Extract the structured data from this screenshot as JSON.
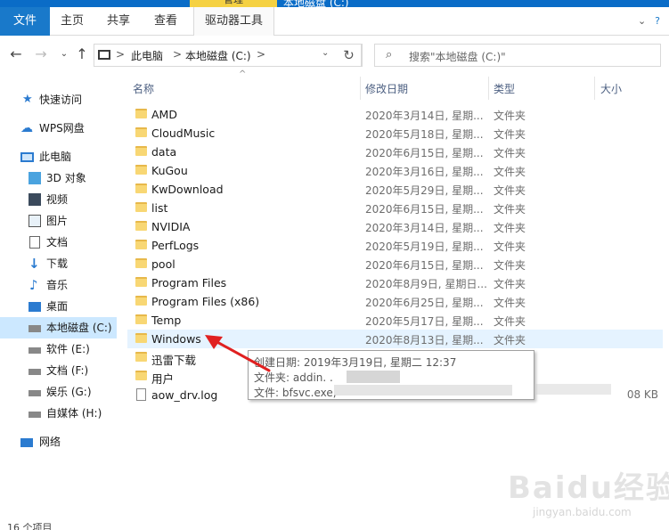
{
  "titlebar": {
    "manage_label": "管理",
    "title": "本地磁盘 (C:)"
  },
  "ribbon": {
    "tabs": {
      "file": "文件",
      "home": "主页",
      "share": "共享",
      "view": "查看",
      "drive_tools": "驱动器工具"
    }
  },
  "address": {
    "segments": [
      "此电脑",
      "本地磁盘 (C:)"
    ],
    "separator": ">",
    "search_placeholder": "搜索\"本地磁盘 (C:)\""
  },
  "nav": {
    "items": [
      {
        "label": "快速访问",
        "icon": "star-icon"
      },
      {
        "label": "WPS网盘",
        "icon": "cloud-icon"
      },
      {
        "label": "此电脑",
        "icon": "computer-icon"
      },
      {
        "label": "3D 对象",
        "icon": "cube-icon"
      },
      {
        "label": "视频",
        "icon": "video-icon"
      },
      {
        "label": "图片",
        "icon": "picture-icon"
      },
      {
        "label": "文档",
        "icon": "document-icon"
      },
      {
        "label": "下载",
        "icon": "download-icon"
      },
      {
        "label": "音乐",
        "icon": "music-icon"
      },
      {
        "label": "桌面",
        "icon": "desktop-icon"
      },
      {
        "label": "本地磁盘 (C:)",
        "icon": "drive-icon",
        "selected": true
      },
      {
        "label": "软件 (E:)",
        "icon": "drive-icon"
      },
      {
        "label": "文档 (F:)",
        "icon": "drive-icon"
      },
      {
        "label": "娱乐 (G:)",
        "icon": "drive-icon"
      },
      {
        "label": "自媒体 (H:)",
        "icon": "drive-icon"
      },
      {
        "label": "网络",
        "icon": "network-icon"
      }
    ]
  },
  "status": {
    "text": "16 个项目"
  },
  "columns": {
    "name": "名称",
    "modified": "修改日期",
    "type": "类型",
    "size": "大小"
  },
  "files": [
    {
      "name": "AMD",
      "date": "2020年3月14日, 星期...",
      "type": "文件夹",
      "size": "",
      "kind": "folder"
    },
    {
      "name": "CloudMusic",
      "date": "2020年5月18日, 星期...",
      "type": "文件夹",
      "size": "",
      "kind": "folder"
    },
    {
      "name": "data",
      "date": "2020年6月15日, 星期...",
      "type": "文件夹",
      "size": "",
      "kind": "folder"
    },
    {
      "name": "KuGou",
      "date": "2020年3月16日, 星期...",
      "type": "文件夹",
      "size": "",
      "kind": "folder"
    },
    {
      "name": "KwDownload",
      "date": "2020年5月29日, 星期...",
      "type": "文件夹",
      "size": "",
      "kind": "folder"
    },
    {
      "name": "list",
      "date": "2020年6月15日, 星期...",
      "type": "文件夹",
      "size": "",
      "kind": "folder"
    },
    {
      "name": "NVIDIA",
      "date": "2020年3月14日, 星期...",
      "type": "文件夹",
      "size": "",
      "kind": "folder"
    },
    {
      "name": "PerfLogs",
      "date": "2020年5月19日, 星期...",
      "type": "文件夹",
      "size": "",
      "kind": "folder"
    },
    {
      "name": "pool",
      "date": "2020年6月15日, 星期...",
      "type": "文件夹",
      "size": "",
      "kind": "folder"
    },
    {
      "name": "Program Files",
      "date": "2020年8月9日, 星期日...",
      "type": "文件夹",
      "size": "",
      "kind": "folder"
    },
    {
      "name": "Program Files (x86)",
      "date": "2020年6月25日, 星期...",
      "type": "文件夹",
      "size": "",
      "kind": "folder"
    },
    {
      "name": "Temp",
      "date": "2020年5月17日, 星期...",
      "type": "文件夹",
      "size": "",
      "kind": "folder"
    },
    {
      "name": "Windows",
      "date": "2020年8月13日, 星期...",
      "type": "文件夹",
      "size": "",
      "kind": "folder",
      "hover": true
    },
    {
      "name": "迅雷下载",
      "date": "",
      "type": "",
      "size": "",
      "kind": "folder"
    },
    {
      "name": "用户",
      "date": "",
      "type": "",
      "size": "",
      "kind": "folder"
    },
    {
      "name": "aow_drv.log",
      "date": "",
      "type": "",
      "size": "08 KB",
      "kind": "file"
    }
  ],
  "tooltip": {
    "created": "创建日期: 2019年3月19日, 星期二 12:37",
    "folders": "文件夹: addin. .",
    "files": "文件: bfsvc.exe,"
  },
  "watermark": {
    "text": "Baidu经验",
    "sub": "jingyan.baidu.com"
  },
  "colors": {
    "accent": "#1979ca",
    "selected": "#cce8ff",
    "hover": "#e5f3ff",
    "manage": "#f5d142",
    "arrow": "#e02020"
  }
}
